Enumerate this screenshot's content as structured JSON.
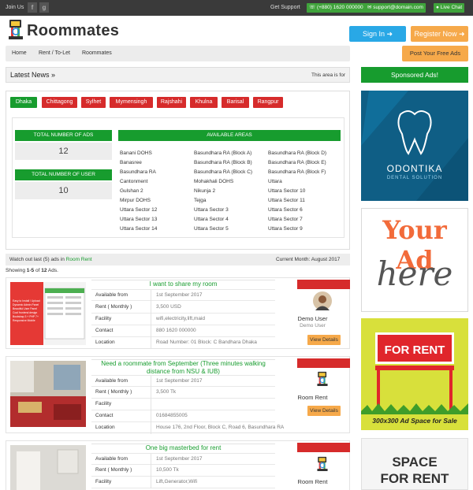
{
  "topbar": {
    "join_us": "Join Us",
    "facebook_glyph": "f",
    "google_glyph": "g",
    "get_support": "Get Support",
    "phone": "(+880) 1620 000000",
    "email": "support@domain.com",
    "live_chat": "Live Chat"
  },
  "header": {
    "logo_text": "Roommates",
    "sign_in": "Sign In",
    "register": "Register Now"
  },
  "nav": {
    "items": [
      "Home",
      "Rent / To-Let",
      "Roommates"
    ],
    "post_button": "Post Your Free Ads"
  },
  "news": {
    "title": "Latest News",
    "ticker": "This area is for"
  },
  "sidebar": {
    "sponsored_title": "Sponsored Ads!",
    "odontika_name": "ODONTIKA",
    "odontika_sub": "DENTAL SOLUTION",
    "your_ad_line1": "Your Ad",
    "your_ad_line2": "here",
    "for_rent": "FOR RENT",
    "ad_space": "300x300 Ad Space for Sale",
    "space_line1": "SPACE",
    "space_line2": "FOR RENT"
  },
  "cities": [
    "Dhaka",
    "Chittagong",
    "Sylhet",
    "Mymensingh",
    "Rajshahi",
    "Khulna",
    "Barisal",
    "Rangpur"
  ],
  "stats": {
    "ads_label": "TOTAL NUMBER OF ADS",
    "ads_value": "12",
    "users_label": "TOTAL NUMBER OF USER",
    "users_value": "10",
    "areas_label": "AVAILABLE AREAS"
  },
  "areas": {
    "col1": [
      "Banani DOHS",
      "Banasree",
      "Basundhara RA",
      "Cantonment",
      "Gulshan 2",
      "Mirpur DOHS",
      "Uttara Sector 12",
      "Uttara Sector 13",
      "Uttara Sector 14"
    ],
    "col2": [
      "Basundhara RA (Block A)",
      "Basundhara RA (Block B)",
      "Basundhara RA (Block C)",
      "Mohakhali DOHS",
      "Nikunja 2",
      "Tejga",
      "Uttara Sector 3",
      "Uttara Sector 4",
      "Uttara Sector 5"
    ],
    "col3": [
      "Basundhara RA (Block D)",
      "Basundhara RA (Block E)",
      "Basundhara RA (Block F)",
      "Uttara",
      "Uttara Sector 10",
      "Uttara Sector 11",
      "Uttara Sector 6",
      "Uttara Sector 7",
      "Uttara Sector 9"
    ]
  },
  "watch": {
    "prefix": "Watch out last (5) ads in",
    "category": "Room Rent",
    "month": "Current Month: August 2017"
  },
  "showing": {
    "prefix": "Showing",
    "range": "1-5",
    "of": "of",
    "total": "12",
    "suffix": "Ads."
  },
  "field_labels": {
    "available": "Available from",
    "rent": "Rent ( Monthly )",
    "facility": "Facility",
    "contact": "Contact",
    "location": "Location"
  },
  "ads": [
    {
      "title": "I want to share my room",
      "available": "1st September 2017",
      "rent": "3,500 USD",
      "facility": "wifi,electricity,lift,maid",
      "contact": "880 1620 000000",
      "location": "Road Number: 01 Block: C Bandhara Dhaka",
      "owner": "Demo User",
      "owner_sub": "Demo User",
      "view": "View Details",
      "thumb_text": "Easy to Install / Upload Dynamic Admin Panel Beautiful User Panel Cool frontend design Bootstrap 3 + PHP 7+ Responsive Mobile"
    },
    {
      "title": "Need a roommate from September (Three minutes walking distance from NSU & IUB)",
      "available": "1st September 2017",
      "rent": "3,500 Tk",
      "facility": "",
      "contact": "01684855005",
      "location": "House 176, 2nd Floor, Block C, Road 6, Basundhara RA",
      "owner": "Room Rent",
      "view": "View Details"
    },
    {
      "title": "One big masterbed for rent",
      "available": "1st September 2017",
      "rent": "10,500 Tk",
      "facility": "Lift,Generator,Wifi",
      "owner": "Room Rent"
    }
  ],
  "colors": {
    "green": "#179c2e",
    "red": "#d62b2b",
    "orange": "#f6a94a",
    "blue": "#29a8e6",
    "dark": "#3a3a3a"
  }
}
